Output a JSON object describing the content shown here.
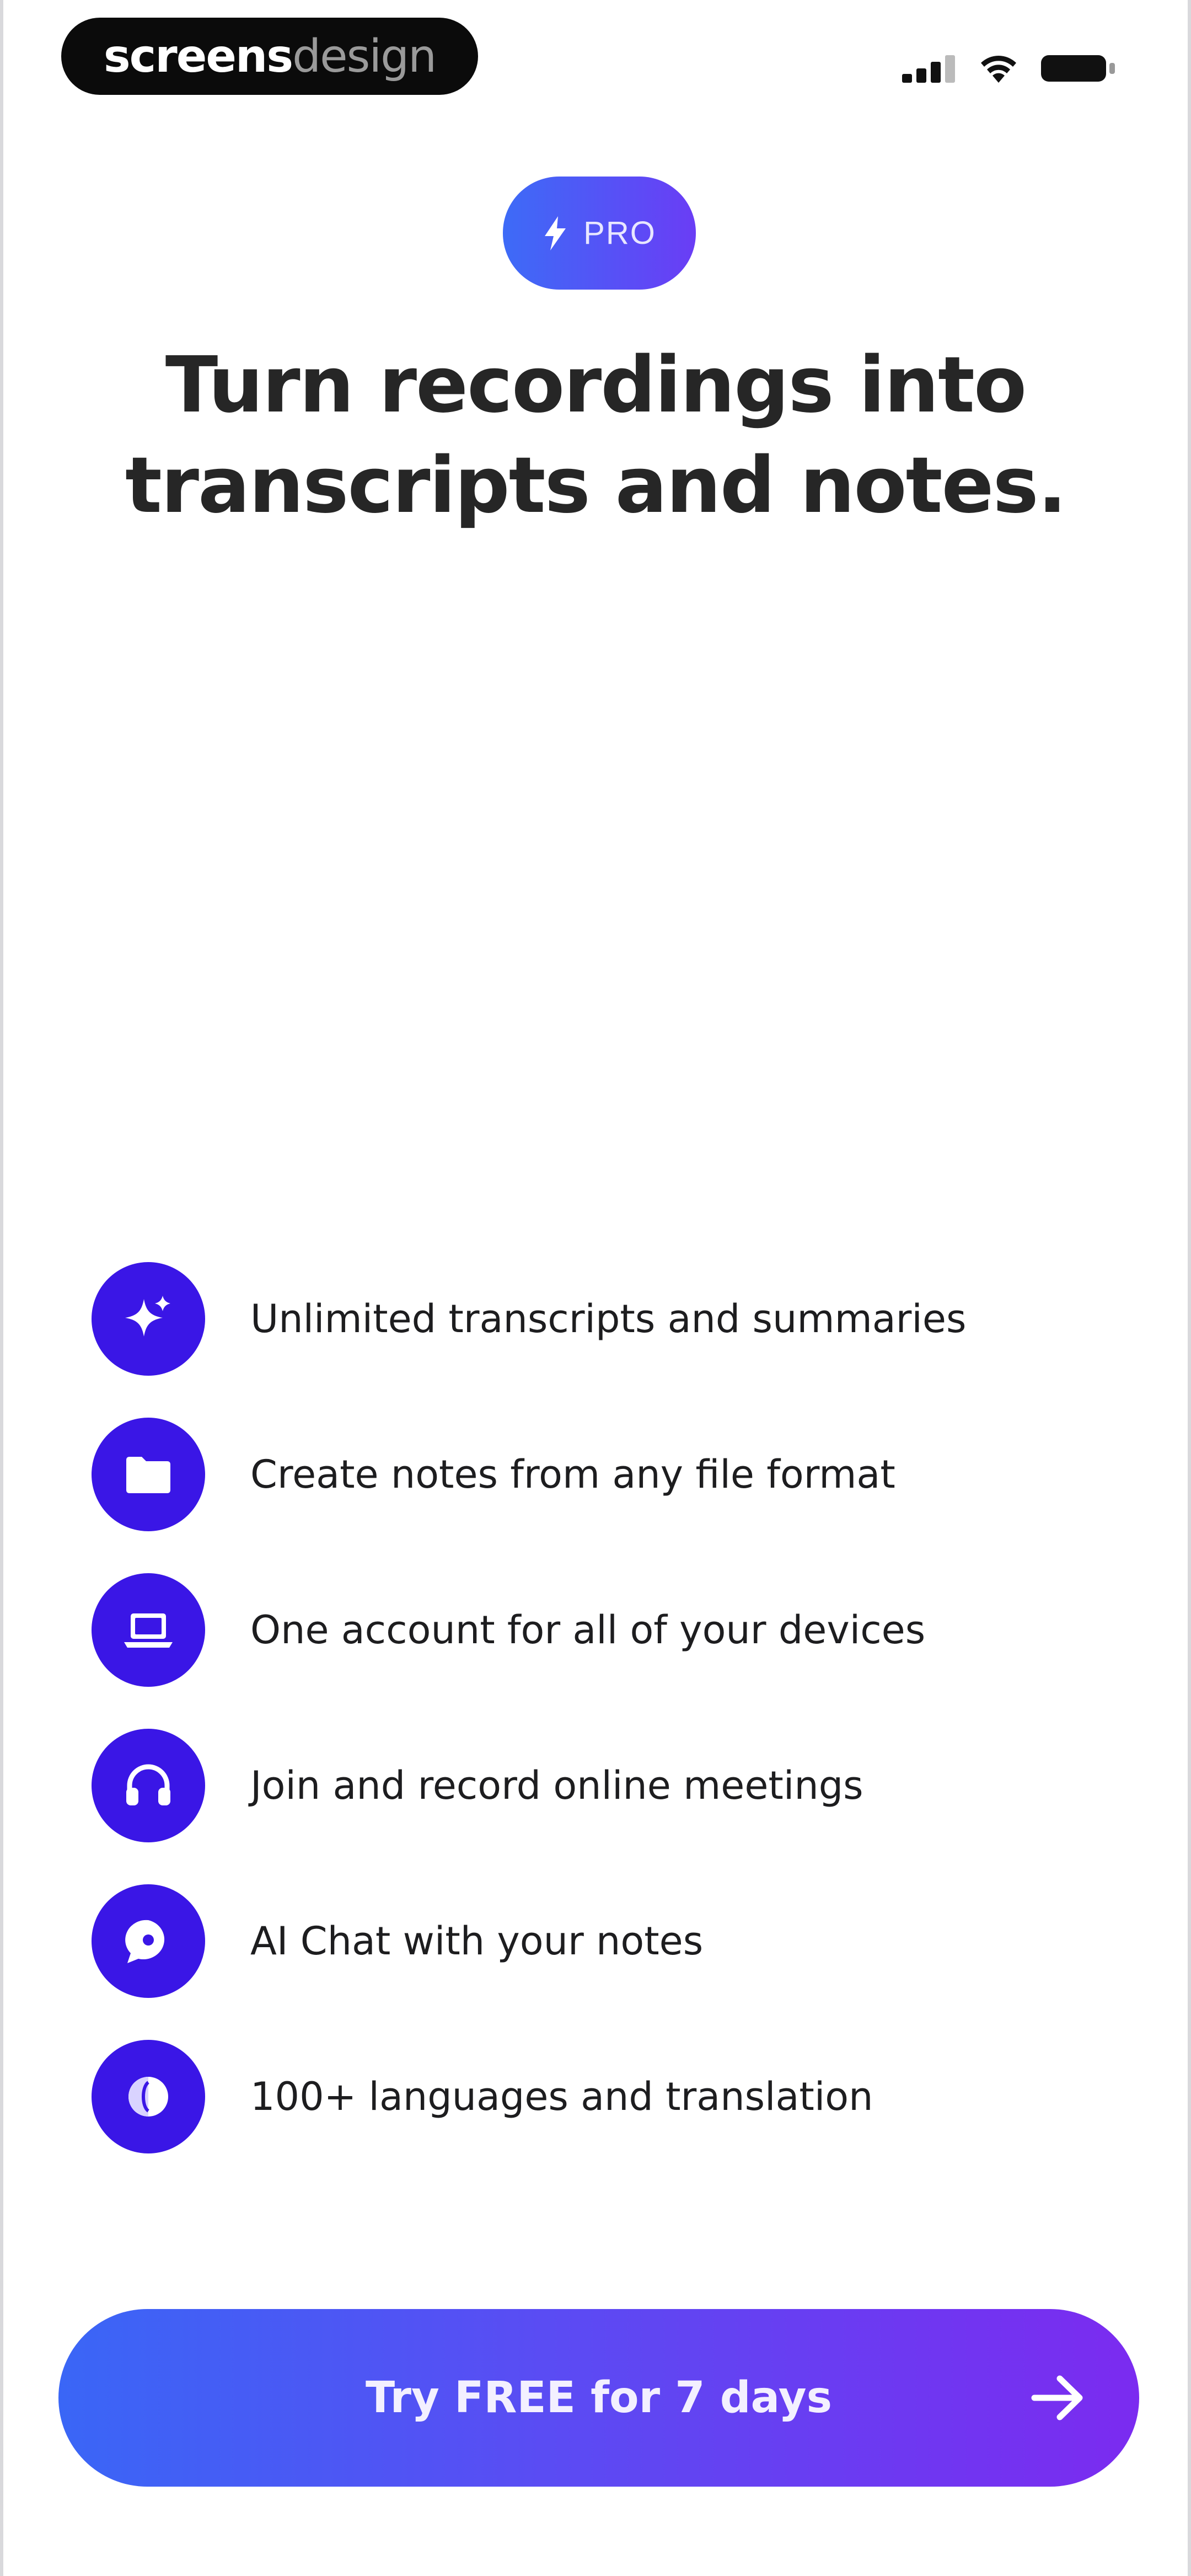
{
  "watermark": {
    "strong": "screens",
    "light": "design"
  },
  "status_bar": {
    "icons": [
      "cellular-signal-icon",
      "wifi-icon",
      "battery-icon"
    ]
  },
  "badge": {
    "label": "PRO",
    "icon": "bolt-icon"
  },
  "headline": {
    "line1": "Turn recordings into",
    "line2": "transcripts and notes."
  },
  "features": [
    {
      "icon": "sparkle-icon",
      "label": "Unlimited transcripts and summaries"
    },
    {
      "icon": "folder-icon",
      "label": "Create notes from any file format"
    },
    {
      "icon": "laptop-icon",
      "label": "One account for all of your devices"
    },
    {
      "icon": "headphones-icon",
      "label": "Join and record online meetings"
    },
    {
      "icon": "chat-bubble-icon",
      "label": "AI Chat with your notes"
    },
    {
      "icon": "language-icon",
      "label": "100+ languages and translation"
    }
  ],
  "cta": {
    "label": "Try FREE for 7 days",
    "icon": "arrow-right-icon"
  },
  "colors": {
    "accent": "#3a16e6",
    "gradient_start": "#3a66f6",
    "gradient_end": "#7b2bf0",
    "headline": "#262626"
  }
}
